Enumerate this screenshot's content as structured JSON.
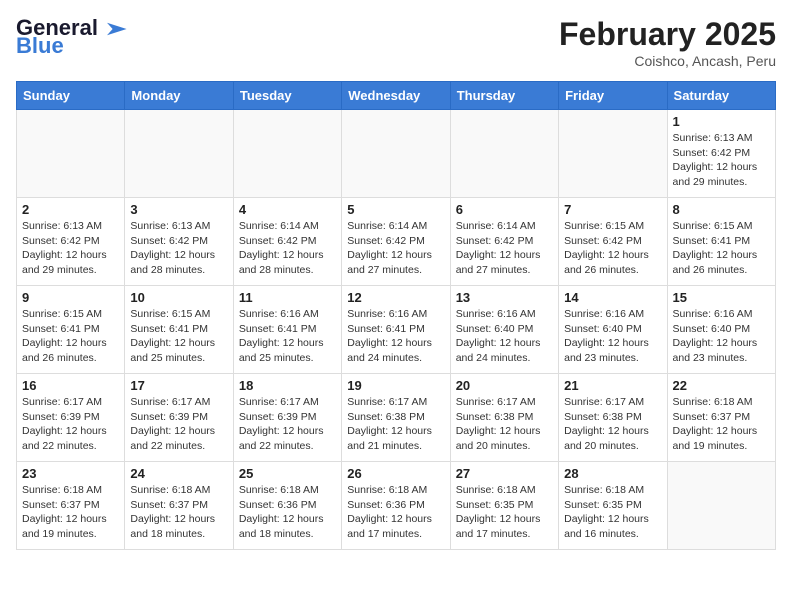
{
  "header": {
    "logo_line1": "General",
    "logo_line2": "Blue",
    "month": "February 2025",
    "location": "Coishco, Ancash, Peru"
  },
  "weekdays": [
    "Sunday",
    "Monday",
    "Tuesday",
    "Wednesday",
    "Thursday",
    "Friday",
    "Saturday"
  ],
  "weeks": [
    [
      {
        "day": "",
        "info": ""
      },
      {
        "day": "",
        "info": ""
      },
      {
        "day": "",
        "info": ""
      },
      {
        "day": "",
        "info": ""
      },
      {
        "day": "",
        "info": ""
      },
      {
        "day": "",
        "info": ""
      },
      {
        "day": "1",
        "info": "Sunrise: 6:13 AM\nSunset: 6:42 PM\nDaylight: 12 hours\nand 29 minutes."
      }
    ],
    [
      {
        "day": "2",
        "info": "Sunrise: 6:13 AM\nSunset: 6:42 PM\nDaylight: 12 hours\nand 29 minutes."
      },
      {
        "day": "3",
        "info": "Sunrise: 6:13 AM\nSunset: 6:42 PM\nDaylight: 12 hours\nand 28 minutes."
      },
      {
        "day": "4",
        "info": "Sunrise: 6:14 AM\nSunset: 6:42 PM\nDaylight: 12 hours\nand 28 minutes."
      },
      {
        "day": "5",
        "info": "Sunrise: 6:14 AM\nSunset: 6:42 PM\nDaylight: 12 hours\nand 27 minutes."
      },
      {
        "day": "6",
        "info": "Sunrise: 6:14 AM\nSunset: 6:42 PM\nDaylight: 12 hours\nand 27 minutes."
      },
      {
        "day": "7",
        "info": "Sunrise: 6:15 AM\nSunset: 6:42 PM\nDaylight: 12 hours\nand 26 minutes."
      },
      {
        "day": "8",
        "info": "Sunrise: 6:15 AM\nSunset: 6:41 PM\nDaylight: 12 hours\nand 26 minutes."
      }
    ],
    [
      {
        "day": "9",
        "info": "Sunrise: 6:15 AM\nSunset: 6:41 PM\nDaylight: 12 hours\nand 26 minutes."
      },
      {
        "day": "10",
        "info": "Sunrise: 6:15 AM\nSunset: 6:41 PM\nDaylight: 12 hours\nand 25 minutes."
      },
      {
        "day": "11",
        "info": "Sunrise: 6:16 AM\nSunset: 6:41 PM\nDaylight: 12 hours\nand 25 minutes."
      },
      {
        "day": "12",
        "info": "Sunrise: 6:16 AM\nSunset: 6:41 PM\nDaylight: 12 hours\nand 24 minutes."
      },
      {
        "day": "13",
        "info": "Sunrise: 6:16 AM\nSunset: 6:40 PM\nDaylight: 12 hours\nand 24 minutes."
      },
      {
        "day": "14",
        "info": "Sunrise: 6:16 AM\nSunset: 6:40 PM\nDaylight: 12 hours\nand 23 minutes."
      },
      {
        "day": "15",
        "info": "Sunrise: 6:16 AM\nSunset: 6:40 PM\nDaylight: 12 hours\nand 23 minutes."
      }
    ],
    [
      {
        "day": "16",
        "info": "Sunrise: 6:17 AM\nSunset: 6:39 PM\nDaylight: 12 hours\nand 22 minutes."
      },
      {
        "day": "17",
        "info": "Sunrise: 6:17 AM\nSunset: 6:39 PM\nDaylight: 12 hours\nand 22 minutes."
      },
      {
        "day": "18",
        "info": "Sunrise: 6:17 AM\nSunset: 6:39 PM\nDaylight: 12 hours\nand 22 minutes."
      },
      {
        "day": "19",
        "info": "Sunrise: 6:17 AM\nSunset: 6:38 PM\nDaylight: 12 hours\nand 21 minutes."
      },
      {
        "day": "20",
        "info": "Sunrise: 6:17 AM\nSunset: 6:38 PM\nDaylight: 12 hours\nand 20 minutes."
      },
      {
        "day": "21",
        "info": "Sunrise: 6:17 AM\nSunset: 6:38 PM\nDaylight: 12 hours\nand 20 minutes."
      },
      {
        "day": "22",
        "info": "Sunrise: 6:18 AM\nSunset: 6:37 PM\nDaylight: 12 hours\nand 19 minutes."
      }
    ],
    [
      {
        "day": "23",
        "info": "Sunrise: 6:18 AM\nSunset: 6:37 PM\nDaylight: 12 hours\nand 19 minutes."
      },
      {
        "day": "24",
        "info": "Sunrise: 6:18 AM\nSunset: 6:37 PM\nDaylight: 12 hours\nand 18 minutes."
      },
      {
        "day": "25",
        "info": "Sunrise: 6:18 AM\nSunset: 6:36 PM\nDaylight: 12 hours\nand 18 minutes."
      },
      {
        "day": "26",
        "info": "Sunrise: 6:18 AM\nSunset: 6:36 PM\nDaylight: 12 hours\nand 17 minutes."
      },
      {
        "day": "27",
        "info": "Sunrise: 6:18 AM\nSunset: 6:35 PM\nDaylight: 12 hours\nand 17 minutes."
      },
      {
        "day": "28",
        "info": "Sunrise: 6:18 AM\nSunset: 6:35 PM\nDaylight: 12 hours\nand 16 minutes."
      },
      {
        "day": "",
        "info": ""
      }
    ]
  ]
}
